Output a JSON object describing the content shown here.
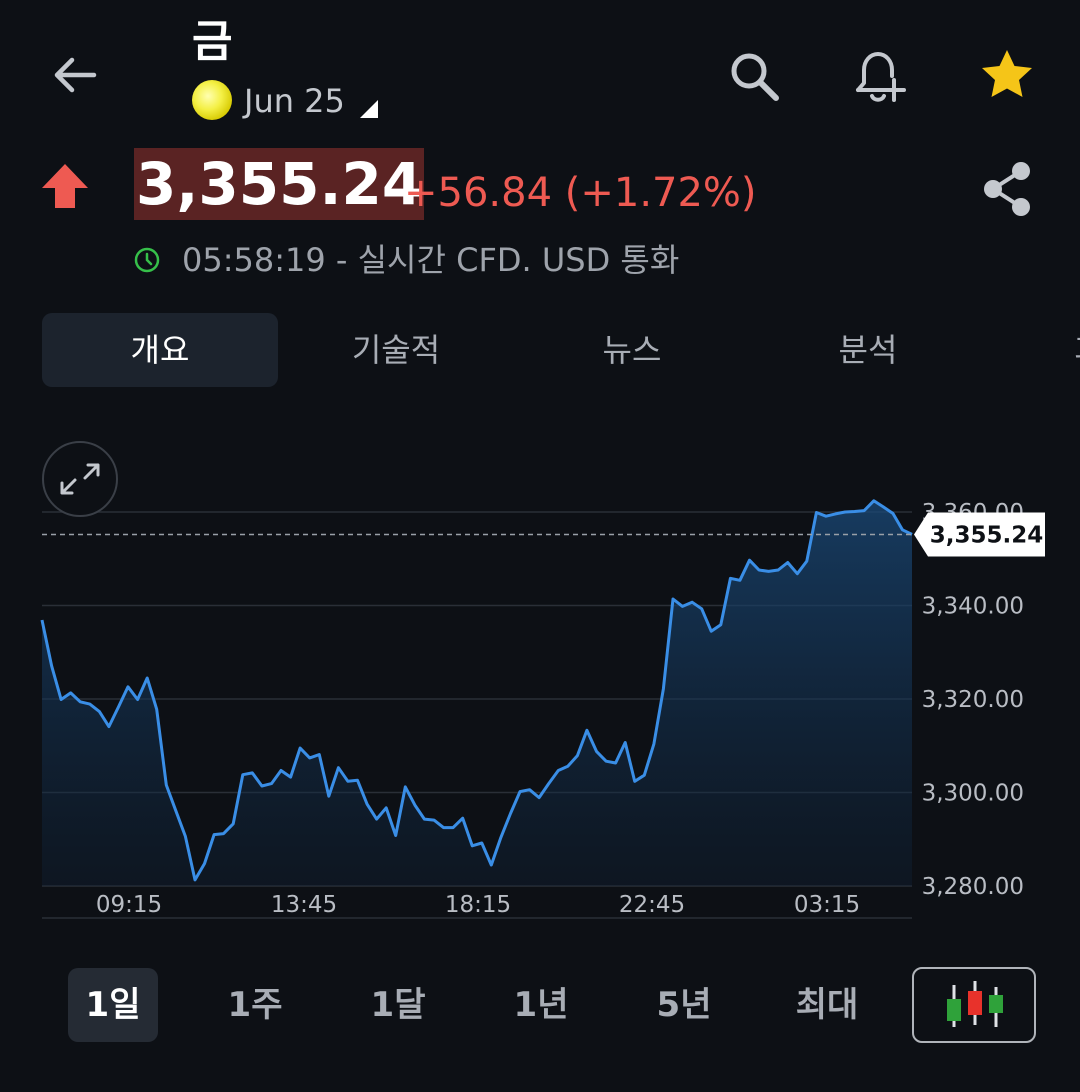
{
  "header": {
    "title": "금",
    "contract": "Jun 25"
  },
  "quote": {
    "price": "3,355.24",
    "change": "+56.84 (+1.72%)",
    "time_info": "05:58:19 - 실시간 CFD. USD 통화"
  },
  "tabs": [
    "개요",
    "기술적",
    "뉴스",
    "분석",
    "과거"
  ],
  "ranges": [
    "1일",
    "1주",
    "1달",
    "1년",
    "5년",
    "최대"
  ],
  "colors": {
    "background": "#0d1015",
    "up": "#ee5a52",
    "line": "#3a8ee6",
    "star": "#f5c518"
  },
  "chart_data": {
    "type": "area",
    "ylim": [
      3280,
      3360
    ],
    "y_ticks": [
      "3,360.00",
      "3,340.00",
      "3,320.00",
      "3,300.00",
      "3,280.00"
    ],
    "x_ticks": [
      "09:15",
      "13:45",
      "18:15",
      "22:45",
      "03:15"
    ],
    "last_value_label": "3,355.24",
    "values": [
      3336.9,
      3327.1,
      3319.9,
      3321.3,
      3319.4,
      3318.9,
      3317.3,
      3314.1,
      3318.3,
      3322.6,
      3319.9,
      3324.5,
      3317.8,
      3301.6,
      3296.1,
      3290.6,
      3281.3,
      3284.8,
      3291.0,
      3291.2,
      3293.3,
      3303.8,
      3304.2,
      3301.4,
      3301.9,
      3304.7,
      3303.3,
      3309.5,
      3307.4,
      3308.1,
      3299.2,
      3305.3,
      3302.4,
      3302.6,
      3297.5,
      3294.3,
      3296.7,
      3290.8,
      3301.2,
      3297.3,
      3294.3,
      3294.1,
      3292.5,
      3292.5,
      3294.5,
      3288.6,
      3289.2,
      3284.5,
      3290.4,
      3295.5,
      3300.2,
      3300.6,
      3298.9,
      3301.9,
      3304.7,
      3305.6,
      3307.9,
      3313.3,
      3308.8,
      3306.7,
      3306.3,
      3310.7,
      3302.4,
      3303.7,
      3310.4,
      3322.2,
      3341.4,
      3339.8,
      3340.7,
      3339.3,
      3334.5,
      3335.9,
      3345.8,
      3345.4,
      3349.7,
      3347.6,
      3347.3,
      3347.6,
      3349.2,
      3346.8,
      3349.5,
      3359.9,
      3359.1,
      3359.6,
      3360.0,
      3360.1,
      3360.3,
      3362.4,
      3361.1,
      3359.7,
      3356.2,
      3355.2
    ]
  }
}
